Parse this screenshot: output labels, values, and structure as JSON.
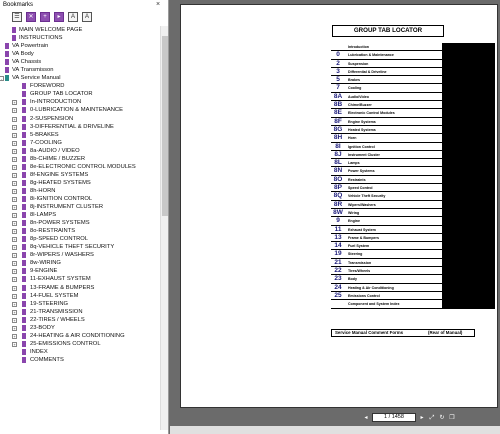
{
  "bookmarks_panel": {
    "title": "Bookmarks",
    "close_glyph": "×",
    "toolbar": [
      {
        "icon": "options-icon",
        "glyph": "☰"
      },
      {
        "icon": "delete-bookmark-icon",
        "glyph": "✕"
      },
      {
        "icon": "new-bookmark-icon",
        "glyph": "+"
      },
      {
        "icon": "expand-bookmark-icon",
        "glyph": "▸"
      },
      {
        "icon": "enlarge-text-icon",
        "glyph": "A"
      },
      {
        "icon": "reduce-text-icon",
        "glyph": "A"
      }
    ],
    "items": [
      {
        "label": "MAIN WELCOME PAGE",
        "level": 0,
        "expand": ""
      },
      {
        "label": "INSTRUCTIONS",
        "level": 0,
        "expand": ""
      },
      {
        "label": "VA Powertrain",
        "level": 0,
        "expand": ""
      },
      {
        "label": "VA Body",
        "level": 0,
        "expand": ""
      },
      {
        "label": "VA Chassis",
        "level": 0,
        "expand": ""
      },
      {
        "label": "VA Transmisson",
        "level": 0,
        "expand": ""
      },
      {
        "label": "VA Service Manual",
        "level": 0,
        "expand": "-",
        "open": true
      },
      {
        "label": "FOREWORD",
        "level": 1,
        "expand": ""
      },
      {
        "label": "GROUP TAB LOCATOR",
        "level": 1,
        "expand": ""
      },
      {
        "label": "In-INTRODUCTION",
        "level": 1,
        "expand": "+"
      },
      {
        "label": "0-LUBRICATION & MAINTENANCE",
        "level": 1,
        "expand": "+"
      },
      {
        "label": "2-SUSPENSION",
        "level": 1,
        "expand": "+"
      },
      {
        "label": "3-DIFFERENTIAL & DRIVELINE",
        "level": 1,
        "expand": "+"
      },
      {
        "label": "5-BRAKES",
        "level": 1,
        "expand": "+"
      },
      {
        "label": "7-COOLING",
        "level": 1,
        "expand": "+"
      },
      {
        "label": "8a-AUDIO / VIDEO",
        "level": 1,
        "expand": "+"
      },
      {
        "label": "8b-CHIME / BUZZER",
        "level": 1,
        "expand": "+"
      },
      {
        "label": "8e-ELECTRONIC CONTROL MODULES",
        "level": 1,
        "expand": "+"
      },
      {
        "label": "8f-ENGINE SYSTEMS",
        "level": 1,
        "expand": "+"
      },
      {
        "label": "8g-HEATED SYSTEMS",
        "level": 1,
        "expand": "+"
      },
      {
        "label": "8h-HORN",
        "level": 1,
        "expand": "+"
      },
      {
        "label": "8i-IGNITION CONTROL",
        "level": 1,
        "expand": "+"
      },
      {
        "label": "8j-INSTRUMENT CLUSTER",
        "level": 1,
        "expand": "+"
      },
      {
        "label": "8l-LAMPS",
        "level": 1,
        "expand": "+"
      },
      {
        "label": "8n-POWER SYSTEMS",
        "level": 1,
        "expand": "+"
      },
      {
        "label": "8o-RESTRAINTS",
        "level": 1,
        "expand": "+"
      },
      {
        "label": "8p-SPEED CONTROL",
        "level": 1,
        "expand": "+"
      },
      {
        "label": "8q-VEHICLE THEFT SECURITY",
        "level": 1,
        "expand": "+"
      },
      {
        "label": "8r-WIPERS / WASHERS",
        "level": 1,
        "expand": "+"
      },
      {
        "label": "8w-WIRING",
        "level": 1,
        "expand": "+"
      },
      {
        "label": "9-ENGINE",
        "level": 1,
        "expand": "+"
      },
      {
        "label": "11-EXHAUST SYSTEM",
        "level": 1,
        "expand": "+"
      },
      {
        "label": "13-FRAME & BUMPERS",
        "level": 1,
        "expand": "+"
      },
      {
        "label": "14-FUEL SYSTEM",
        "level": 1,
        "expand": "+"
      },
      {
        "label": "19-STEERING",
        "level": 1,
        "expand": "+"
      },
      {
        "label": "21-TRANSMISSION",
        "level": 1,
        "expand": "+"
      },
      {
        "label": "22-TIRES / WHEELS",
        "level": 1,
        "expand": "+"
      },
      {
        "label": "23-BODY",
        "level": 1,
        "expand": "+"
      },
      {
        "label": "24-HEATING & AIR CONDITIONING",
        "level": 1,
        "expand": "+"
      },
      {
        "label": "25-EMISSIONS CONTROL",
        "level": 1,
        "expand": "+"
      },
      {
        "label": "INDEX",
        "level": 1,
        "expand": ""
      },
      {
        "label": "COMMENTS",
        "level": 1,
        "expand": ""
      }
    ]
  },
  "document_page": {
    "title": "GROUP TAB LOCATOR",
    "rows": [
      {
        "num": "",
        "label": "Introduction"
      },
      {
        "num": "0",
        "label": "Lubrication & Maintenance"
      },
      {
        "num": "2",
        "label": "Suspension"
      },
      {
        "num": "3",
        "label": "Differential & Driveline"
      },
      {
        "num": "5",
        "label": "Brakes"
      },
      {
        "num": "7",
        "label": "Cooling"
      },
      {
        "num": "8A",
        "label": "Audio/Video"
      },
      {
        "num": "8B",
        "label": "Chime/Buzzer"
      },
      {
        "num": "8E",
        "label": "Electronic Control Modules"
      },
      {
        "num": "8F",
        "label": "Engine Systems"
      },
      {
        "num": "8G",
        "label": "Heated Systems"
      },
      {
        "num": "8H",
        "label": "Horn"
      },
      {
        "num": "8I",
        "label": "Ignition Control"
      },
      {
        "num": "8J",
        "label": "Instrument Cluster"
      },
      {
        "num": "8L",
        "label": "Lamps"
      },
      {
        "num": "8N",
        "label": "Power Systems"
      },
      {
        "num": "8O",
        "label": "Restraints"
      },
      {
        "num": "8P",
        "label": "Speed Control"
      },
      {
        "num": "8Q",
        "label": "Vehicle Theft Security"
      },
      {
        "num": "8R",
        "label": "Wipers/Washers"
      },
      {
        "num": "8W",
        "label": "Wiring"
      },
      {
        "num": "9",
        "label": "Engine"
      },
      {
        "num": "11",
        "label": "Exhaust System"
      },
      {
        "num": "13",
        "label": "Frame & Bumpers"
      },
      {
        "num": "14",
        "label": "Fuel System"
      },
      {
        "num": "19",
        "label": "Steering"
      },
      {
        "num": "21",
        "label": "Transmission"
      },
      {
        "num": "22",
        "label": "Tires/Wheels"
      },
      {
        "num": "23",
        "label": "Body"
      },
      {
        "num": "24",
        "label": "Heating & Air Conditioning"
      },
      {
        "num": "25",
        "label": "Emissions Control"
      },
      {
        "num": "",
        "label": "Component and System Index"
      }
    ],
    "comment_left": "Service Manual Comment Forms",
    "comment_right": "(Rear of Manual)"
  },
  "page_nav": {
    "current_page": "1 / 1458",
    "prev_glyph": "◂",
    "next_glyph": "▸",
    "fit_glyph": "⤢",
    "rotate_glyph": "↻",
    "copy_glyph": "❐"
  },
  "colors": {
    "bookmark": "#8a45ad",
    "bookmark_open": "#2a8d89",
    "tab_number": "#1b1b7a"
  }
}
